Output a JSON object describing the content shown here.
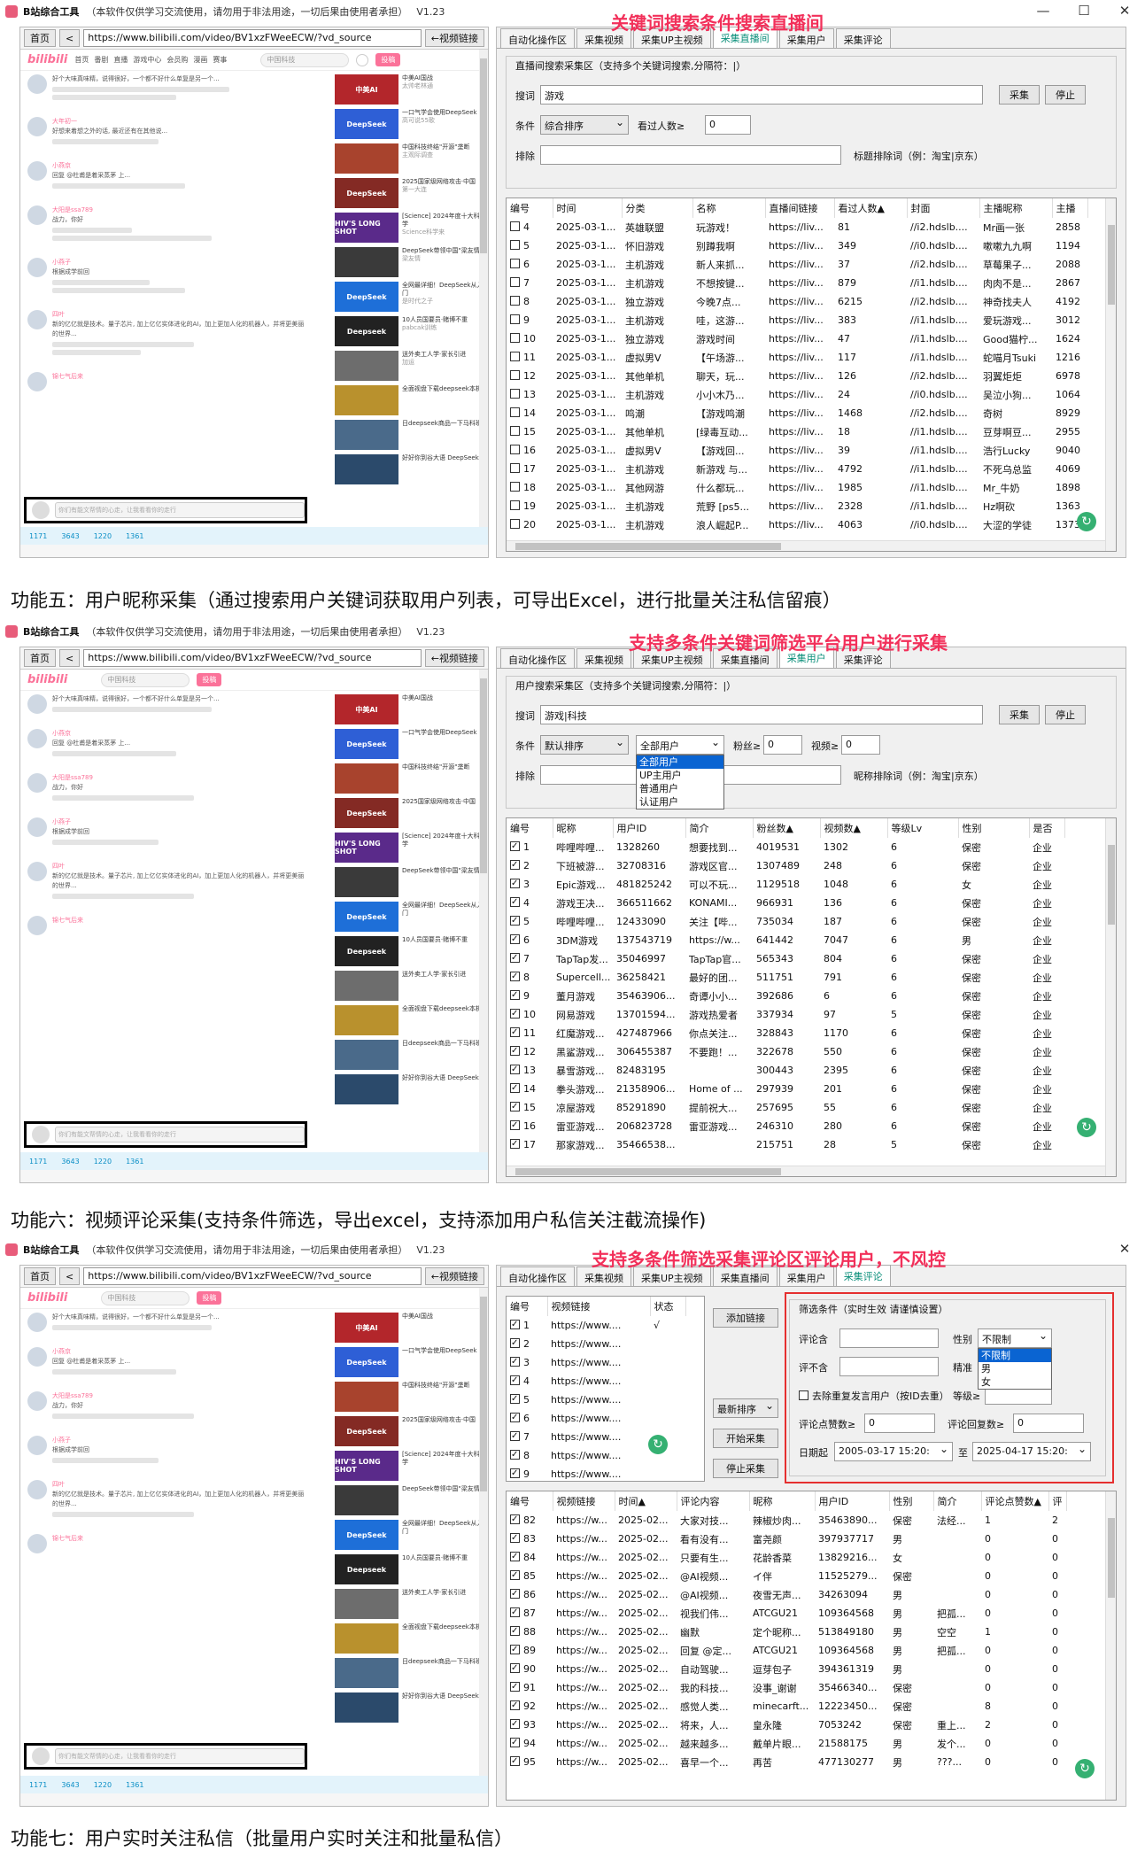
{
  "app": {
    "title": "B站综合工具",
    "note": "（本软件仅供学习交流使用，请勿用于非法用途，一切后果由使用者承担）",
    "version": "V1.23"
  },
  "browser": {
    "home": "首页",
    "back": "<",
    "url": "https://www.bilibili.com/video/BV1xzFWeeECW/?vd_source",
    "video_link": "←视频链接"
  },
  "bili": {
    "logo": "bilibili",
    "nav": [
      "首页",
      "番剧",
      "直播",
      "游戏中心",
      "会员购",
      "漫画",
      "赛事"
    ],
    "search_placeholder": "中国科技",
    "upload": "投稿",
    "comments": [
      {
        "name": "",
        "text": "好个大味真味精，说得很好，一个都不好什么单复是另一个..."
      },
      {
        "name": "大年初一",
        "text": "好想来着想之外的话, 最近还有在其他说..."
      },
      {
        "name": "小燕京",
        "text": "回复 @杜甫是着采蒸茅 上..."
      },
      {
        "name": "大阳是ssa789",
        "text": "战力，你好"
      },
      {
        "name": "小燕子",
        "text": "根据成学前回"
      },
      {
        "name": "四叶",
        "text": "新的亿亿就是技术。量子芯片, 加上亿亿实体进化的AI，加上更加人化的机器人，并将更美丽的世界..."
      },
      {
        "name": "锦七气后来",
        "text": ""
      }
    ],
    "comment_placeholder": "你们有能文帮情的心走，让我看看你的走行",
    "bottom": [
      "1171",
      "3643",
      "1220",
      "1361"
    ],
    "videos": [
      {
        "thumb": "中美AI",
        "title": "中美AI国战",
        "meta": "太帅老林通"
      },
      {
        "thumb": "DeepSeek",
        "title": "一口气学会使用DeepSeek",
        "meta": "高可说55歌"
      },
      {
        "thumb": "",
        "title": "中国科技终结\"开源\"垄断",
        "meta": "主观际调查"
      },
      {
        "thumb": "DeepSeek",
        "title": "2025国家级网络攻击·中国",
        "meta": "第一大连"
      },
      {
        "thumb": "HIV'S LONG SHOT",
        "title": "[Science] 2024年度十大科学",
        "meta": "Science科学来"
      },
      {
        "thumb": "",
        "title": "DeepSeek带领中国\"梁友情",
        "meta": "梁友情"
      },
      {
        "thumb": "DeepSeek",
        "title": "全网最详细！DeepSeek从入门",
        "meta": "是时代之子"
      },
      {
        "thumb": "Deepseek",
        "title": "10人员国要员·赌博不重",
        "meta": "pabcak训练"
      },
      {
        "thumb": "",
        "title": "送外卖工人学·家长引进",
        "meta": "加运"
      },
      {
        "thumb": "",
        "title": "全面视盘下载deepseek本机",
        "meta": ""
      },
      {
        "thumb": "",
        "title": "日deepseek商品一下马科班",
        "meta": ""
      },
      {
        "thumb": "",
        "title": "好好你到谷大语 DeepSeek",
        "meta": ""
      }
    ]
  },
  "tabs": [
    "自动化操作区",
    "采集视频",
    "采集UP主视频",
    "采集直播间",
    "采集用户",
    "采集评论"
  ],
  "section1": {
    "annotation": "关键词搜索条件搜索直播间",
    "group_title": "直播间搜索采集区（支持多个关键词搜索,分隔符：|）",
    "search_label": "搜词",
    "search_value": "游戏",
    "collect": "采集",
    "stop": "停止",
    "cond_label": "条件",
    "sort": "综合排序",
    "viewers_label": "看过人数≥",
    "viewers_value": "0",
    "exclude_label": "排除",
    "exclude_hint": "标题排除词（例：淘宝|京东）",
    "columns": [
      "编号",
      "时间",
      "分类",
      "名称",
      "直播间链接",
      "看过人数▲",
      "封面",
      "主播昵称",
      "主播"
    ],
    "rows": [
      [
        "4",
        "2025-03-1...",
        "英雄联盟",
        "玩游戏！",
        "https://liv...",
        "81",
        "//i2.hdslb....",
        "Mr画一张",
        "2858"
      ],
      [
        "5",
        "2025-03-1...",
        "怀旧游戏",
        "别蹲我啊",
        "https://liv...",
        "349",
        "//i0.hdslb....",
        "嗽嗽九九啊",
        "1194"
      ],
      [
        "6",
        "2025-03-1...",
        "主机游戏",
        "新人来抓...",
        "https://liv...",
        "37",
        "//i2.hdslb....",
        "草莓果子...",
        "2088"
      ],
      [
        "7",
        "2025-03-1...",
        "主机游戏",
        "不想按键...",
        "https://liv...",
        "879",
        "//i1.hdslb....",
        "肉肉不是...",
        "2867"
      ],
      [
        "8",
        "2025-03-1...",
        "独立游戏",
        "今晚7点...",
        "https://liv...",
        "6215",
        "//i2.hdslb....",
        "神奇找夫人",
        "4192"
      ],
      [
        "9",
        "2025-03-1...",
        "主机游戏",
        "哇，这游...",
        "https://liv...",
        "383",
        "//i1.hdslb....",
        "爱玩游戏...",
        "3012"
      ],
      [
        "10",
        "2025-03-1...",
        "独立游戏",
        "游戏时间",
        "https://liv...",
        "47",
        "//i1.hdslb....",
        "Good猫柠...",
        "1624"
      ],
      [
        "11",
        "2025-03-1...",
        "虚拟男V",
        "【午场游...",
        "https://liv...",
        "117",
        "//i1.hdslb....",
        "蛇喵月Tsuki",
        "1216"
      ],
      [
        "12",
        "2025-03-1...",
        "其他单机",
        "聊天，玩...",
        "https://liv...",
        "126",
        "//i2.hdslb....",
        "羽翼炬炬",
        "6978"
      ],
      [
        "13",
        "2025-03-1...",
        "主机游戏",
        "小小木乃...",
        "https://liv...",
        "24",
        "//i0.hdslb....",
        "吴泣小狗...",
        "1064"
      ],
      [
        "14",
        "2025-03-1...",
        "鸣潮",
        "【游戏鸣潮",
        "https://liv...",
        "1468",
        "//i2.hdslb....",
        "奇树",
        "8929"
      ],
      [
        "15",
        "2025-03-1...",
        "其他单机",
        "[绿毒互动...",
        "https://liv...",
        "18",
        "//i1.hdslb....",
        "豆芽啊豆...",
        "2955"
      ],
      [
        "16",
        "2025-03-1...",
        "虚拟男V",
        "【游戏回...",
        "https://liv...",
        "39",
        "//i1.hdslb....",
        "浩行Lucky",
        "9040"
      ],
      [
        "17",
        "2025-03-1...",
        "主机游戏",
        "新游戏 与...",
        "https://liv...",
        "4792",
        "//i1.hdslb....",
        "不死乌总监",
        "4069"
      ],
      [
        "18",
        "2025-03-1...",
        "其他网游",
        "什么都玩...",
        "https://liv...",
        "1985",
        "//i1.hdslb....",
        "Mr_牛奶",
        "1898"
      ],
      [
        "19",
        "2025-03-1...",
        "主机游戏",
        "荒野 [ps5...",
        "https://liv...",
        "2328",
        "//i1.hdslb....",
        "Hz啊砍",
        "1363"
      ],
      [
        "20",
        "2025-03-1...",
        "主机游戏",
        "浪人崛起P...",
        "https://liv...",
        "4063",
        "//i0.hdslb....",
        "大涩的学徒",
        "1373"
      ]
    ]
  },
  "caption1": "功能五：用户昵称采集（通过搜索用户关键词获取用户列表，可导出Excel，进行批量关注私信留痕）",
  "section2": {
    "annotation": "支持多条件关键词筛选平台用户进行采集",
    "group_title": "用户搜索采集区（支持多个关键词搜索,分隔符：|）",
    "search_label": "搜词",
    "search_value": "游戏|科技",
    "collect": "采集",
    "stop": "停止",
    "cond_label": "条件",
    "sort": "默认排序",
    "user_type": "全部用户",
    "fans_label": "粉丝≥",
    "fans_value": "0",
    "videos_label": "视频≥",
    "videos_value": "0",
    "exclude_label": "排除",
    "exclude_hint": "昵称排除词（例：淘宝|京东）",
    "dropdown": [
      "全部用户",
      "UP主用户",
      "普通用户",
      "认证用户"
    ],
    "columns": [
      "编号",
      "昵称",
      "用户ID",
      "简介",
      "粉丝数▲",
      "视频数▲",
      "等级Lv",
      "性别",
      "是否"
    ],
    "rows": [
      [
        "1",
        "哔哩哔哩...",
        "1328260",
        "想要找到...",
        "4019531",
        "1302",
        "6",
        "保密",
        "企业"
      ],
      [
        "2",
        "下班被游...",
        "32708316",
        "游戏区官...",
        "1307489",
        "248",
        "6",
        "保密",
        "企业"
      ],
      [
        "3",
        "Epic游戏...",
        "481825242",
        "可以不玩...",
        "1129518",
        "1048",
        "6",
        "女",
        "企业"
      ],
      [
        "4",
        "游戏王决...",
        "366511662",
        "KONAMI...",
        "966931",
        "136",
        "6",
        "保密",
        "企业"
      ],
      [
        "5",
        "哔哩哔哩...",
        "12433090",
        "关注【哔...",
        "735034",
        "187",
        "6",
        "保密",
        "企业"
      ],
      [
        "6",
        "3DM游戏",
        "137543719",
        "https://w...",
        "641442",
        "7047",
        "6",
        "男",
        "企业"
      ],
      [
        "7",
        "TapTap发...",
        "35046997",
        "TapTap官...",
        "565343",
        "804",
        "6",
        "保密",
        "企业"
      ],
      [
        "8",
        "Supercell...",
        "36258421",
        "最好的团...",
        "511751",
        "791",
        "6",
        "保密",
        "企业"
      ],
      [
        "9",
        "董月游戏",
        "35463906...",
        "奇谭小小...",
        "392686",
        "6",
        "6",
        "保密",
        "企业"
      ],
      [
        "10",
        "网易游戏",
        "13701594...",
        "游戏热爱者",
        "337934",
        "97",
        "5",
        "保密",
        "企业"
      ],
      [
        "11",
        "红魔游戏...",
        "427487966",
        "你点关注...",
        "328843",
        "1170",
        "6",
        "保密",
        "企业"
      ],
      [
        "12",
        "黑鲨游戏...",
        "306455387",
        "不要跑！...",
        "322678",
        "550",
        "6",
        "保密",
        "企业"
      ],
      [
        "13",
        "暴雪游戏...",
        "82483195",
        "",
        "300443",
        "2395",
        "6",
        "保密",
        "企业"
      ],
      [
        "14",
        "拳头游戏...",
        "21358906...",
        "Home of ...",
        "297939",
        "201",
        "6",
        "保密",
        "企业"
      ],
      [
        "15",
        "凉屋游戏",
        "85291890",
        "提前祝大...",
        "257695",
        "55",
        "6",
        "保密",
        "企业"
      ],
      [
        "16",
        "雷亚游戏...",
        "206823728",
        "雷亚游戏...",
        "246310",
        "280",
        "6",
        "保密",
        "企业"
      ],
      [
        "17",
        "那家游戏...",
        "35466538...",
        "",
        "215751",
        "28",
        "5",
        "保密",
        "企业"
      ]
    ]
  },
  "caption2": "功能六：视频评论采集(支持条件筛选，导出excel，支持添加用户私信关注截流操作)",
  "section3": {
    "annotation": "支持多条件筛选采集评论区评论用户，不风控",
    "link_columns": [
      "编号",
      "视频链接",
      "状态"
    ],
    "links": [
      [
        "1",
        "https://www....",
        "√"
      ],
      [
        "2",
        "https://www....",
        ""
      ],
      [
        "3",
        "https://www....",
        ""
      ],
      [
        "4",
        "https://www....",
        ""
      ],
      [
        "5",
        "https://www....",
        ""
      ],
      [
        "6",
        "https://www....",
        ""
      ],
      [
        "7",
        "https://www....",
        ""
      ],
      [
        "8",
        "https://www....",
        ""
      ],
      [
        "9",
        "https://www....",
        ""
      ]
    ],
    "add_link": "添加链接",
    "sort": "最新排序",
    "start": "开始采集",
    "stop": "停止采集",
    "filter_title": "筛选条件（实时生效 请谨慎设置）",
    "include_label": "评论含",
    "exclude_label": "评不含",
    "gender_label": "性别",
    "gender_value": "不限制",
    "gender_options": [
      "不限制",
      "男",
      "女"
    ],
    "fine_label": "精准",
    "level_label": "等级≥",
    "dedupe": "去除重复发言用户（按ID去重）",
    "likes_label": "评论点赞数≥",
    "likes_value": "0",
    "replies_label": "评论回复数≥",
    "replies_value": "0",
    "date_label": "日期起",
    "date_from": "2005-03-17 15:20:",
    "date_to_label": "至",
    "date_to": "2025-04-17 15:20:",
    "columns": [
      "编号",
      "视频链接",
      "时间▲",
      "评论内容",
      "昵称",
      "用户ID",
      "性别",
      "简介",
      "评论点赞数▲",
      "评"
    ],
    "rows": [
      [
        "82",
        "https://w...",
        "2025-02...",
        "大家对技...",
        "辣椒炒肉...",
        "35463890...",
        "保密",
        "法经...",
        "1",
        "2"
      ],
      [
        "83",
        "https://w...",
        "2025-02...",
        "看有没有...",
        "富尧颜",
        "397937717",
        "男",
        "",
        "0",
        "0"
      ],
      [
        "84",
        "https://w...",
        "2025-02...",
        "只要有生...",
        "花龄香菜",
        "13829216...",
        "女",
        "",
        "0",
        "0"
      ],
      [
        "85",
        "https://w...",
        "2025-02...",
        "@AI视频...",
        "イ伴",
        "11525279...",
        "保密",
        "",
        "0",
        "0"
      ],
      [
        "86",
        "https://w...",
        "2025-02...",
        "@AI视频...",
        "夜雪无声...",
        "34263094",
        "男",
        "",
        "0",
        "0"
      ],
      [
        "87",
        "https://w...",
        "2025-02...",
        "视我们伟...",
        "ATCGU21",
        "109364568",
        "男",
        "把孤...",
        "0",
        "0"
      ],
      [
        "88",
        "https://w...",
        "2025-02...",
        "幽默",
        "定个昵称...",
        "513849180",
        "男",
        "空空",
        "1",
        "0"
      ],
      [
        "89",
        "https://w...",
        "2025-02...",
        "回复 @定...",
        "ATCGU21",
        "109364568",
        "男",
        "把孤...",
        "0",
        "0"
      ],
      [
        "90",
        "https://w...",
        "2025-02...",
        "自动驾驶...",
        "逗芽包子",
        "394361319",
        "男",
        "",
        "0",
        "0"
      ],
      [
        "91",
        "https://w...",
        "2025-02...",
        "我的科技...",
        "没事_谢谢",
        "35466340...",
        "保密",
        "",
        "0",
        "0"
      ],
      [
        "92",
        "https://w...",
        "2025-02...",
        "感觉人类...",
        "minecarft...",
        "12223450...",
        "保密",
        "",
        "8",
        "0"
      ],
      [
        "93",
        "https://w...",
        "2025-02...",
        "将来，人...",
        "皇永隆",
        "7053242",
        "保密",
        "重上...",
        "2",
        "0"
      ],
      [
        "94",
        "https://w...",
        "2025-02...",
        "越来越多...",
        "戴单片眼...",
        "21588175",
        "男",
        "发个...",
        "0",
        "0"
      ],
      [
        "95",
        "https://w...",
        "2025-02...",
        "喜早一个...",
        "再苦",
        "477130277",
        "男",
        "???...",
        "0",
        "0"
      ]
    ]
  },
  "caption3": "功能七：用户实时关注私信（批量用户实时关注和批量私信）"
}
